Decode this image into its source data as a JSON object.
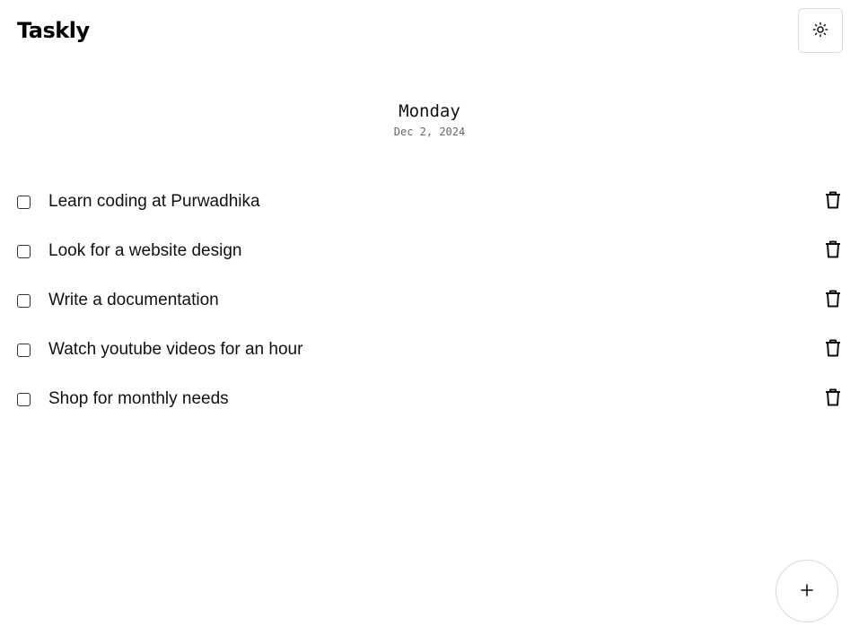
{
  "app": {
    "title": "Taskly"
  },
  "header": {
    "theme_toggle_icon": "sun-icon"
  },
  "day": {
    "name": "Monday",
    "date": "Dec 2, 2024"
  },
  "tasks": [
    {
      "label": "Learn coding at Purwadhika",
      "done": false
    },
    {
      "label": "Look for a website design",
      "done": false
    },
    {
      "label": "Write a documentation",
      "done": false
    },
    {
      "label": "Watch youtube videos for an hour",
      "done": false
    },
    {
      "label": "Shop for monthly needs",
      "done": false
    }
  ],
  "icons": {
    "delete": "trash-icon",
    "add": "plus-icon"
  },
  "fab": {
    "label": "+"
  }
}
